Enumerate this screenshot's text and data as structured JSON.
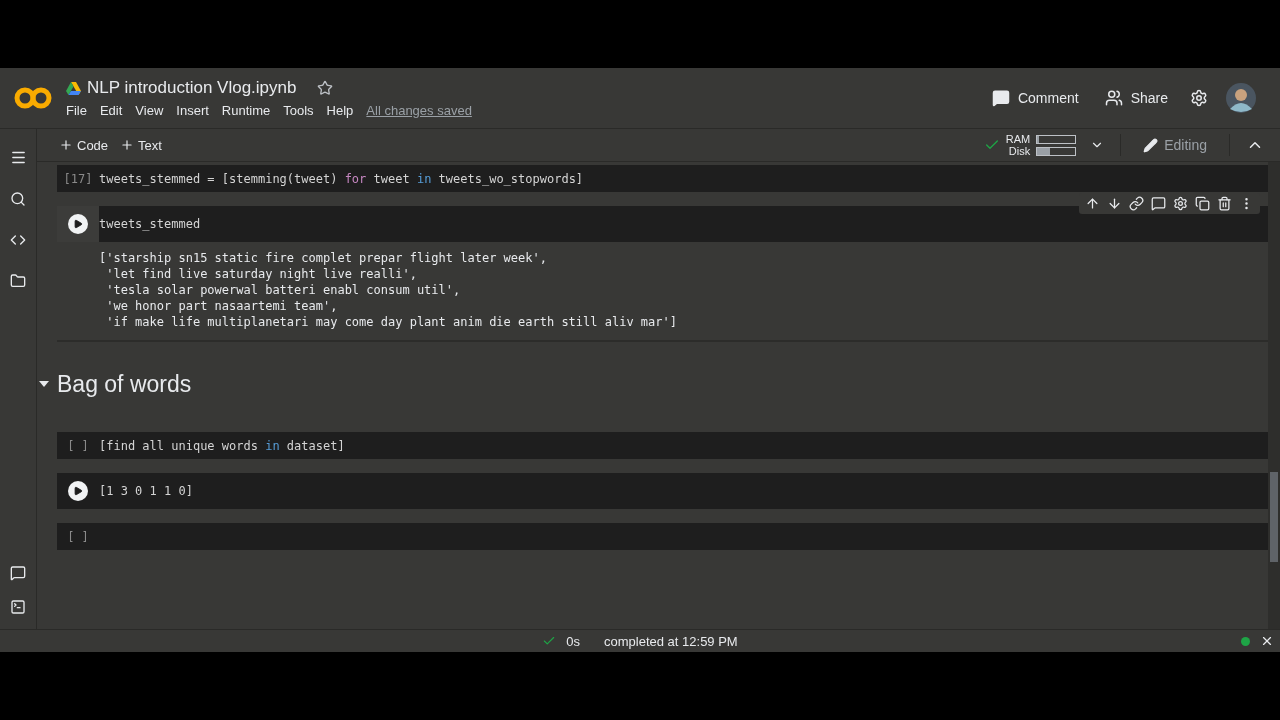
{
  "header": {
    "title": "NLP introduction Vlog.ipynb",
    "starred": false,
    "menu": [
      "File",
      "Edit",
      "View",
      "Insert",
      "Runtime",
      "Tools",
      "Help"
    ],
    "save_status": "All changes saved",
    "actions": [
      {
        "kind": "comment",
        "label": "Comment"
      },
      {
        "kind": "share",
        "label": "Share"
      }
    ]
  },
  "toolbar": {
    "add_buttons": [
      "Code",
      "Text"
    ],
    "connected": true,
    "resources": [
      {
        "label": "RAM",
        "level": 0.05
      },
      {
        "label": "Disk",
        "level": 0.35
      }
    ],
    "mode": "Editing"
  },
  "cells": [
    {
      "kind": "code",
      "selected": false,
      "prompt": "[17]",
      "lines": [
        [
          {
            "text": "tweets_stemmed = [stemming(tweet) ",
            "kind": "plain"
          },
          {
            "text": "for",
            "kind": "keyword"
          },
          {
            "text": " tweet ",
            "kind": "plain"
          },
          {
            "text": "in",
            "kind": "operator"
          },
          {
            "text": " tweets_wo_stopwords]",
            "kind": "plain"
          }
        ]
      ]
    },
    {
      "kind": "code",
      "selected": true,
      "lines": [
        [
          {
            "text": "tweets_stemmed",
            "kind": "plain"
          }
        ]
      ],
      "output": [
        "['starship sn15 static fire complet prepar flight later week',",
        " 'let find live saturday night live realli',",
        " 'tesla solar powerwal batteri enabl consum util',",
        " 'we honor part nasaartemi team',",
        " 'if make life multiplanetari may come day plant anim die earth still aliv mar']"
      ]
    },
    {
      "kind": "heading",
      "expanded": true,
      "text": "Bag of words"
    },
    {
      "kind": "code",
      "selected": false,
      "prompt": "[ ]",
      "lines": [
        [
          {
            "text": "[find all unique words ",
            "kind": "plain"
          },
          {
            "text": "in",
            "kind": "operator"
          },
          {
            "text": " dataset]",
            "kind": "plain"
          }
        ]
      ]
    },
    {
      "kind": "code",
      "selected": false,
      "lines": [
        [
          {
            "text": "[1 3 0 1 1 0]",
            "kind": "plain"
          }
        ]
      ]
    },
    {
      "kind": "code",
      "selected": false,
      "prompt": "[ ]"
    }
  ],
  "status_bar": {
    "success": true,
    "duration": "0s",
    "message": "completed at 12:59 PM",
    "connected": true
  }
}
